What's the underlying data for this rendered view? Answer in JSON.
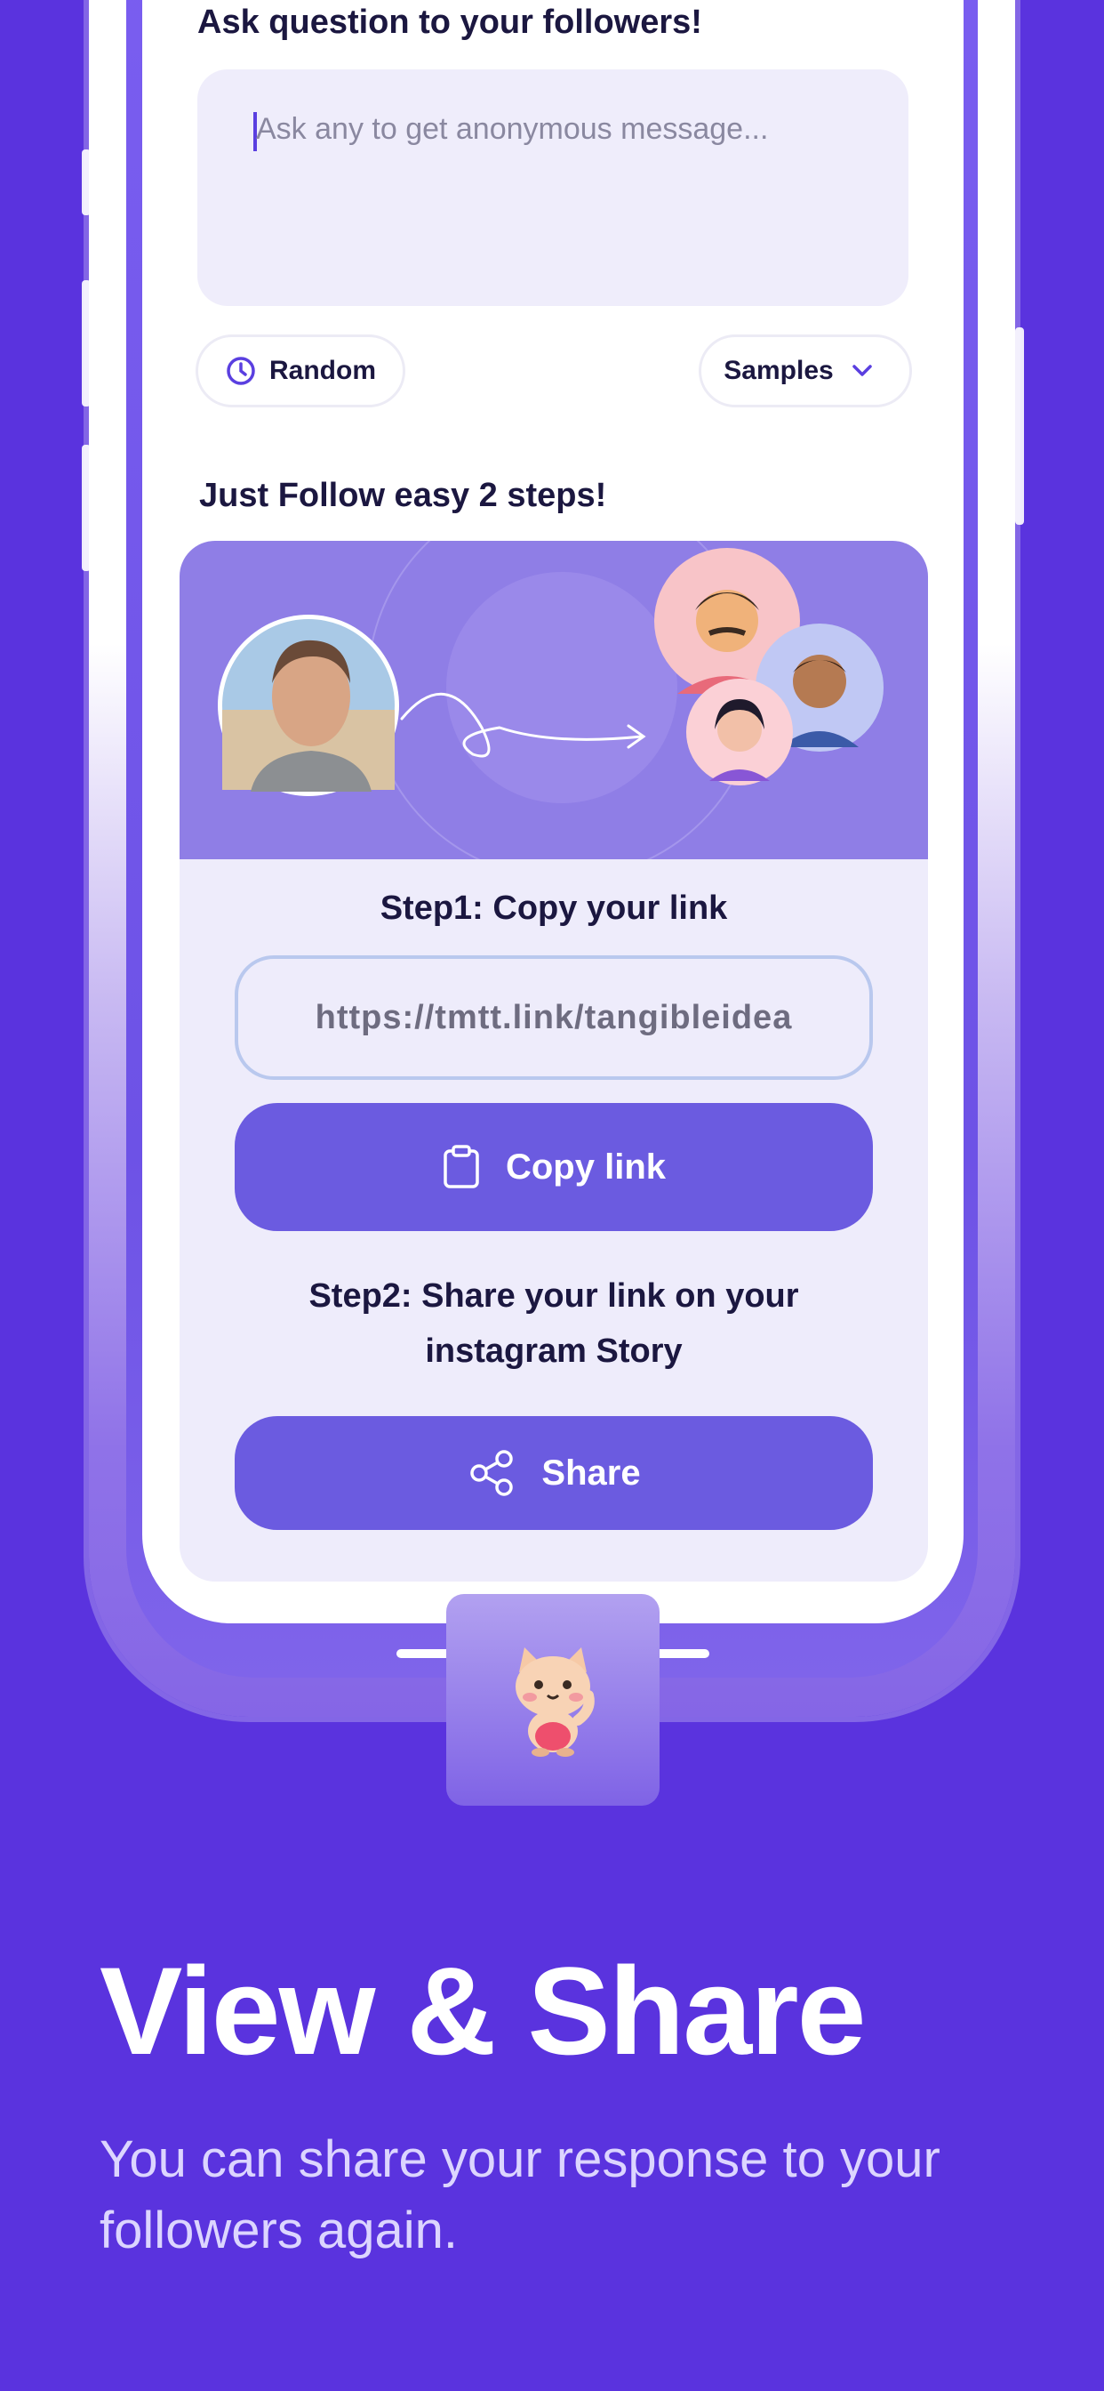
{
  "form": {
    "heading": "Ask question to your followers!",
    "placeholder": "Ask any to get anonymous message...",
    "random_label": "Random",
    "samples_label": "Samples"
  },
  "steps": {
    "heading": "Just Follow easy 2 steps!",
    "step1_label": "Step1: Copy your link",
    "link_value": "https://tmtt.link/tangibleidea",
    "copy_button": "Copy link",
    "step2_label_line1": "Step2: Share your link on your",
    "step2_label_line2": "instagram Story",
    "share_button": "Share"
  },
  "promo": {
    "headline": "View & Share",
    "subtext_line1": "You can share your response to your",
    "subtext_line2": "followers again."
  },
  "colors": {
    "background": "#5a33de",
    "accent": "#6b5be0",
    "hero": "#8f7ee6"
  },
  "icons": [
    "clock-icon",
    "chevron-down-icon",
    "clipboard-icon",
    "share-icon",
    "mascot-icon"
  ]
}
